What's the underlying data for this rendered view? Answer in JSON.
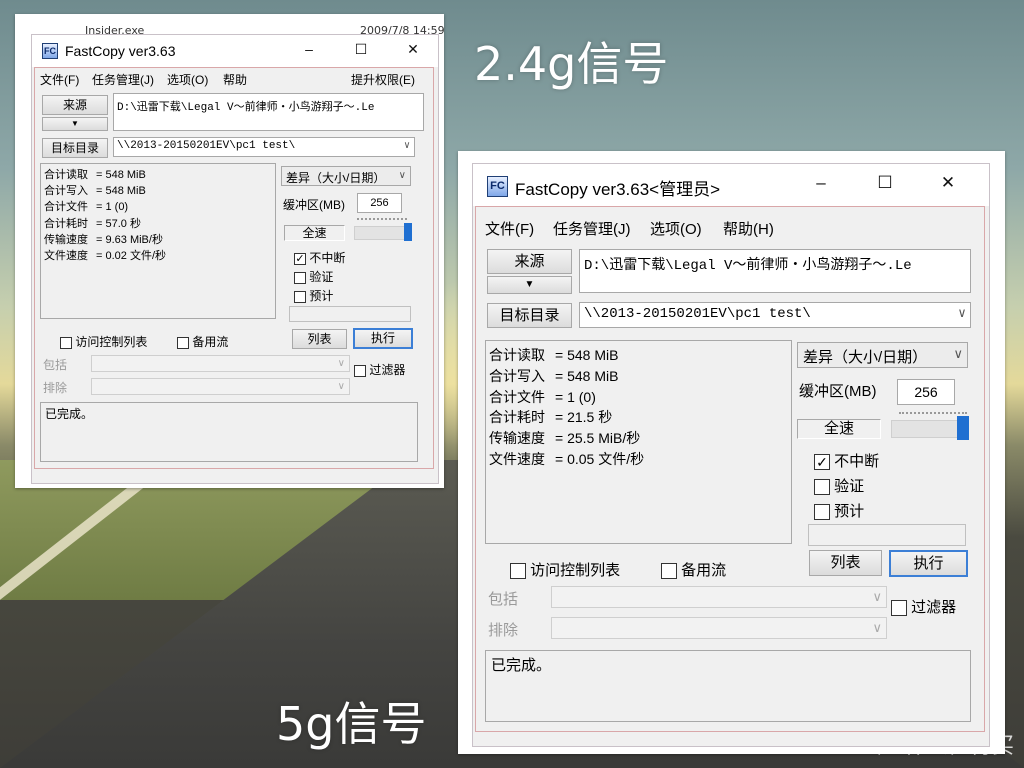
{
  "captions": {
    "top": "2.4g信号",
    "bottom": "5g信号"
  },
  "watermark": "值 什么值得买",
  "background_window": {
    "file": "Insider.exe",
    "date": "2009/7/8 14:59"
  },
  "win_a": {
    "title": "FastCopy ver3.63",
    "title_buttons": [
      "–",
      "☐",
      "✕"
    ],
    "menu": [
      "文件(F)",
      "任务管理(J)",
      "选项(O)",
      "帮助"
    ],
    "menu_right": "提升权限(E)",
    "source_button": "来源",
    "source_path": "D:\\迅雷下载\\Legal V～前律师・小鸟游翔子～.Le",
    "dest_button": "目标目录",
    "dest_path": "\\\\2013-20150201EV\\pc1 test\\",
    "stats": [
      {
        "label": "合计读取",
        "value": "= 548 MiB"
      },
      {
        "label": "合计写入",
        "value": "= 548 MiB"
      },
      {
        "label": "合计文件",
        "value": "= 1 (0)"
      },
      {
        "label": "合计耗时",
        "value": "= 57.0 秒"
      },
      {
        "label": "传输速度",
        "value": "= 9.63 MiB/秒"
      },
      {
        "label": "文件速度",
        "value": "= 0.02 文件/秒"
      }
    ],
    "mode": "差异（大小/日期）",
    "buffer_label": "缓冲区(MB)",
    "buffer_value": "256",
    "speed_label": "全速",
    "speed_level": 1.0,
    "options": [
      {
        "label": "不中断",
        "checked": true
      },
      {
        "label": "验证",
        "checked": false
      },
      {
        "label": "预计",
        "checked": false
      }
    ],
    "acl_label": "访问控制列表",
    "stream_label": "备用流",
    "list_button": "列表",
    "exec_button": "执行",
    "include_label": "包括",
    "exclude_label": "排除",
    "filter_label": "过滤器",
    "log": "已完成。"
  },
  "win_b": {
    "title": "FastCopy ver3.63<管理员>",
    "title_buttons": [
      "–",
      "☐",
      "✕"
    ],
    "menu": [
      "文件(F)",
      "任务管理(J)",
      "选项(O)",
      "帮助(H)"
    ],
    "source_button": "来源",
    "source_path": "D:\\迅雷下载\\Legal V～前律师・小鸟游翔子～.Le",
    "dest_button": "目标目录",
    "dest_path": "\\\\2013-20150201EV\\pc1 test\\",
    "stats": [
      {
        "label": "合计读取",
        "value": "= 548 MiB"
      },
      {
        "label": "合计写入",
        "value": "= 548 MiB"
      },
      {
        "label": "合计文件",
        "value": "= 1 (0)"
      },
      {
        "label": "合计耗时",
        "value": "= 21.5 秒"
      },
      {
        "label": "传输速度",
        "value": "= 25.5 MiB/秒"
      },
      {
        "label": "文件速度",
        "value": "= 0.05 文件/秒"
      }
    ],
    "mode": "差异（大小/日期）",
    "buffer_label": "缓冲区(MB)",
    "buffer_value": "256",
    "speed_label": "全速",
    "speed_level": 1.0,
    "options": [
      {
        "label": "不中断",
        "checked": true
      },
      {
        "label": "验证",
        "checked": false
      },
      {
        "label": "预计",
        "checked": false
      }
    ],
    "acl_label": "访问控制列表",
    "stream_label": "备用流",
    "list_button": "列表",
    "exec_button": "执行",
    "include_label": "包括",
    "exclude_label": "排除",
    "filter_label": "过滤器",
    "log": "已完成。"
  },
  "colors": {
    "accent": "#3c7fd6",
    "slider_thumb": "#1f6fd1",
    "frame_border": "#d9a7a9"
  }
}
